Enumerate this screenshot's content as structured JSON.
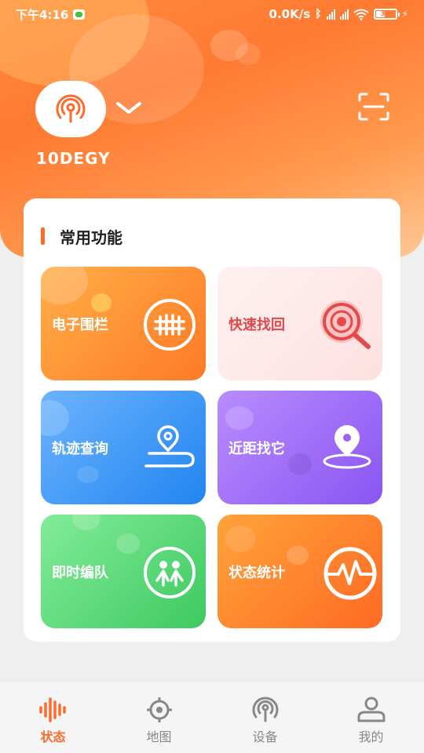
{
  "status_bar": {
    "time": "下午4:16",
    "net_speed": "0.0K/s",
    "battery": "39"
  },
  "device": {
    "name": "10DEGY",
    "icon": "signal-tower-icon"
  },
  "section": {
    "title": "常用功能"
  },
  "functions": [
    {
      "label": "电子围栏",
      "icon": "fence-icon"
    },
    {
      "label": "快速找回",
      "icon": "search-target-icon"
    },
    {
      "label": "轨迹查询",
      "icon": "route-pin-icon"
    },
    {
      "label": "近距找它",
      "icon": "location-pin-icon"
    },
    {
      "label": "即时编队",
      "icon": "group-people-icon"
    },
    {
      "label": "状态统计",
      "icon": "pulse-icon"
    }
  ],
  "bottom_nav": [
    {
      "label": "状态",
      "icon": "waveform-icon",
      "active": true
    },
    {
      "label": "地图",
      "icon": "map-target-icon",
      "active": false
    },
    {
      "label": "设备",
      "icon": "signal-tower-icon",
      "active": false
    },
    {
      "label": "我的",
      "icon": "person-icon",
      "active": false
    }
  ],
  "colors": {
    "accent": "#ff6a2c",
    "header_start": "#ff7a32",
    "header_end": "#ffc895",
    "inactive_nav": "#888888"
  }
}
